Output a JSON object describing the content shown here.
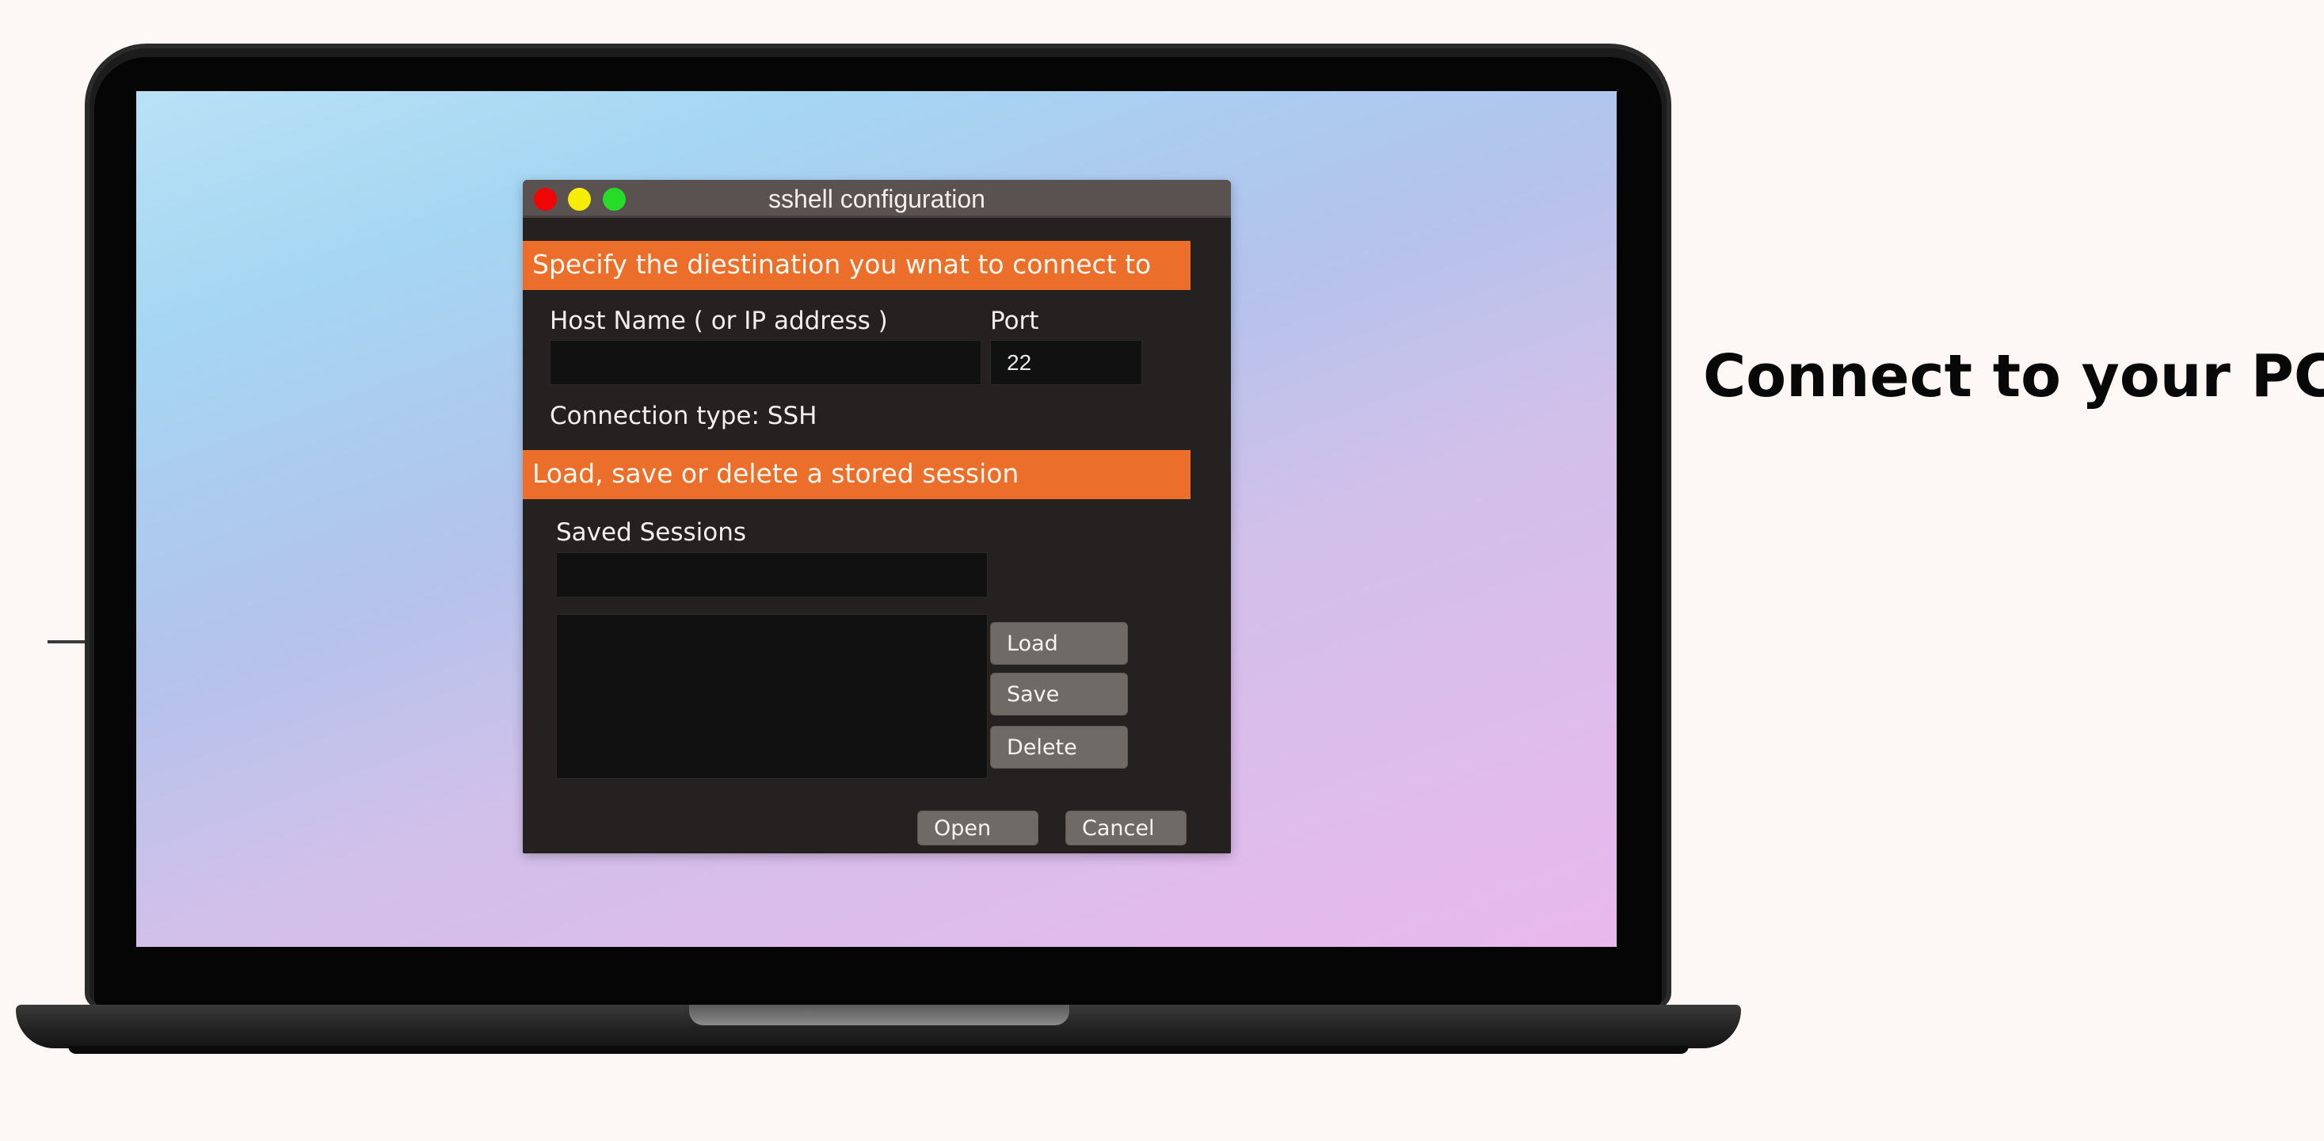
{
  "dialog": {
    "title": "sshell configuration",
    "destination_section": {
      "header": "Specify the diestination you wnat to connect to",
      "host_label": "Host Name ( or IP address )",
      "host_value": "",
      "port_label": "Port",
      "port_value": "22",
      "connection_type": "Connection type: SSH"
    },
    "sessions_section": {
      "header": "Load, save or delete a stored session",
      "saved_sessions_label": "Saved Sessions",
      "session_name_value": "",
      "sessions_list": [],
      "load_label": "Load",
      "save_label": "Save",
      "delete_label": "Delete"
    },
    "open_label": "Open",
    "cancel_label": "Cancel"
  },
  "headline": "Connect to your PC",
  "colors": {
    "accent_orange": "#ec6e2b",
    "dialog_bg": "#252121",
    "titlebar_bg": "#5a5151",
    "button_bg": "#706a67",
    "close_red": "#f00505",
    "minimize_yellow": "#f7ec08",
    "maximize_green": "#26dc26"
  },
  "icons": [
    "close-icon",
    "minimize-icon",
    "maximize-icon"
  ]
}
